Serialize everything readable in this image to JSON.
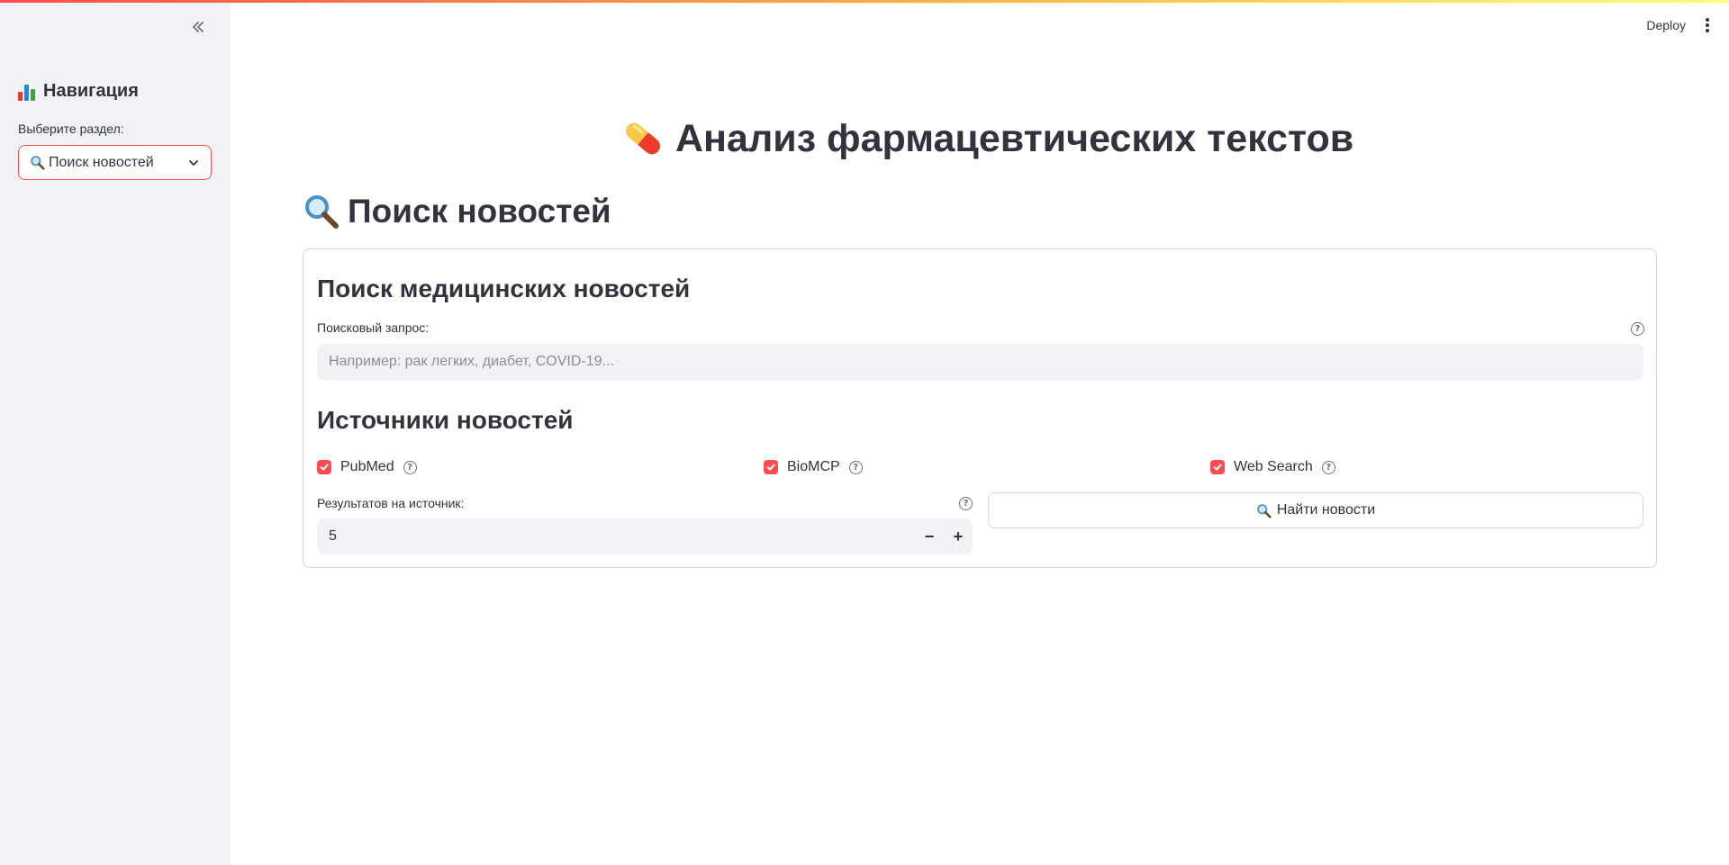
{
  "app": {
    "deploy_label": "Deploy"
  },
  "sidebar": {
    "title": "Навигация",
    "select_label": "Выберите раздел:",
    "selected_option": "Поиск новостей"
  },
  "main": {
    "title": "Анализ фармацевтических текстов",
    "section_title": "Поиск новостей",
    "card": {
      "heading": "Поиск медицинских новостей",
      "query_label": "Поисковый запрос:",
      "query_value": "",
      "query_placeholder": "Например: рак легких, диабет, COVID-19...",
      "sources_heading": "Источники новостей",
      "sources": [
        {
          "label": "PubMed",
          "checked": true
        },
        {
          "label": "BioMCP",
          "checked": true
        },
        {
          "label": "Web Search",
          "checked": true
        }
      ],
      "results_label": "Результатов на источник:",
      "results_value": "5",
      "search_button": "Найти новости"
    }
  },
  "colors": {
    "accent": "#ff4b4b",
    "sidebar_bg": "#f0f2f6",
    "text": "#31333f"
  },
  "icons": {
    "sidebar_title": "bar-chart-icon",
    "select_option": "magnifier-icon",
    "main_title": "pill-icon",
    "section_title": "magnifier-icon",
    "help": "question-circle-icon"
  }
}
